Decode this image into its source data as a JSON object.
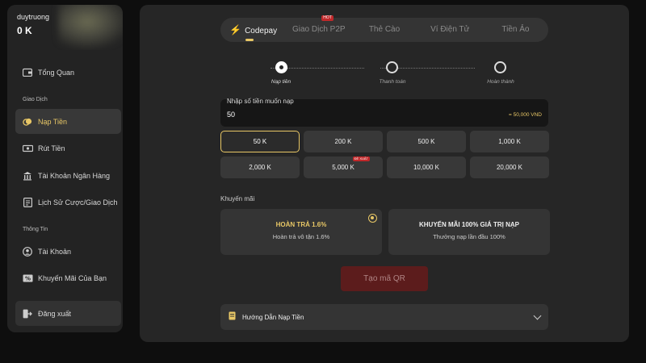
{
  "user": {
    "name": "duytruong",
    "balance": "0 K"
  },
  "sidebar": {
    "overview": {
      "label": "Tổng Quan",
      "icon": "wallet-icon"
    },
    "section_transactions": "Giao Dịch",
    "transactions": [
      {
        "label": "Nạp Tiền",
        "icon": "coins-icon",
        "active": true
      },
      {
        "label": "Rút Tiền",
        "icon": "cash-icon"
      },
      {
        "label": "Tài Khoản Ngân Hàng",
        "icon": "bank-icon"
      },
      {
        "label": "Lịch Sử Cược/Giao Dịch",
        "icon": "history-icon"
      }
    ],
    "section_info": "Thông Tin",
    "info": [
      {
        "label": "Tài Khoản",
        "icon": "user-icon"
      },
      {
        "label": "Khuyến Mãi Của Bạn",
        "icon": "percent-icon"
      }
    ],
    "logout": {
      "label": "Đăng xuất",
      "icon": "logout-icon"
    }
  },
  "tabs": [
    {
      "label": "Codepay",
      "active": true,
      "icon": "bolt-icon"
    },
    {
      "label": "Giao Dịch P2P",
      "badge": "HOT"
    },
    {
      "label": "Thẻ Cào"
    },
    {
      "label": "Ví Điện Tử"
    },
    {
      "label": "Tiền Ảo"
    }
  ],
  "steps": [
    {
      "label": "Nạp tiền",
      "state": "current"
    },
    {
      "label": "Thanh toán",
      "state": "pending"
    },
    {
      "label": "Hoàn thành",
      "state": "pending"
    }
  ],
  "amount": {
    "label": "Nhập số tiền muốn nạp",
    "value": "50",
    "converted": "= 50,000 VND"
  },
  "amount_options": [
    {
      "label": "50 K",
      "selected": true
    },
    {
      "label": "200 K"
    },
    {
      "label": "500 K"
    },
    {
      "label": "1,000 K"
    },
    {
      "label": "2,000 K"
    },
    {
      "label": "5,000 K",
      "badge": "ĐỀ XUẤT"
    },
    {
      "label": "10,000 K"
    },
    {
      "label": "20,000 K"
    }
  ],
  "promotions": {
    "title": "Khuyến mãi",
    "items": [
      {
        "title": "HOÀN TRẢ 1.6%",
        "subtitle": "Hoàn trả vô tận 1.6%",
        "selected": true
      },
      {
        "title": "KHUYẾN MÃI 100% GIÁ TRỊ NẠP",
        "subtitle": "Thưởng nạp lần đầu 100%",
        "selected": false
      }
    ]
  },
  "qr_button": "Tạo mã QR",
  "guide": {
    "label": "Hướng Dẫn Nạp Tiền",
    "icon": "document-icon"
  },
  "colors": {
    "accent": "#e8c766",
    "danger": "#c0282a",
    "panel": "#262626",
    "background": "#0e0e0e"
  }
}
